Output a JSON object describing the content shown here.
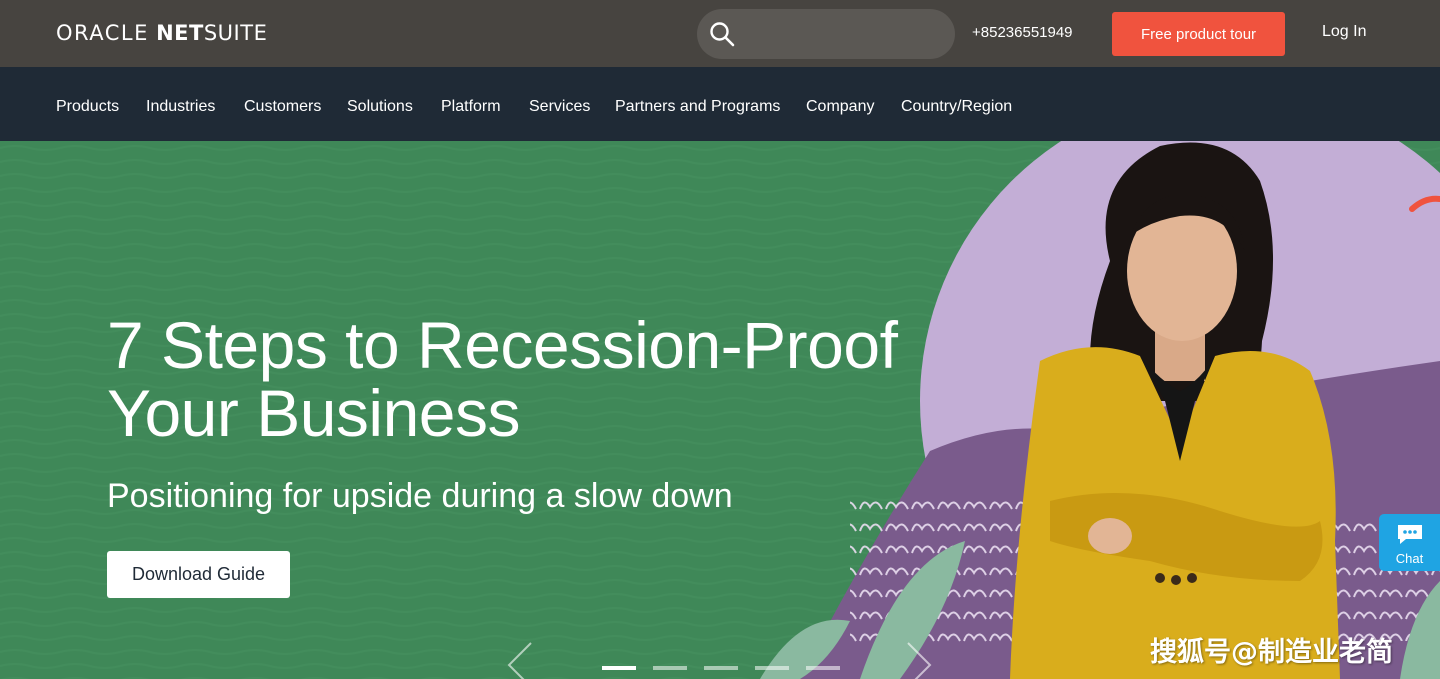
{
  "brand": {
    "logo_part1": "ORACLE",
    "logo_part2": "NET",
    "logo_part3": "SUITE"
  },
  "header": {
    "search_icon": "search-icon",
    "phone": "+85236551949",
    "tour_button": "Free product tour",
    "login": "Log In"
  },
  "nav": {
    "items": [
      {
        "label": "Products"
      },
      {
        "label": "Industries"
      },
      {
        "label": "Customers"
      },
      {
        "label": "Solutions"
      },
      {
        "label": "Platform"
      },
      {
        "label": "Services"
      },
      {
        "label": "Partners and Programs"
      },
      {
        "label": "Company"
      },
      {
        "label": "Country/Region"
      }
    ]
  },
  "hero": {
    "title_line1": "7 Steps to Recession-Proof",
    "title_line2": "Your Business",
    "subtitle": "Positioning for upside during a slow down",
    "cta": "Download Guide",
    "slide_count": 5,
    "active_slide": 1
  },
  "chat": {
    "label": "Chat",
    "icon": "chat-bubble-icon"
  },
  "watermark": "搜狐号@制造业老简",
  "colors": {
    "topbar": "#474440",
    "nav": "#1f2a36",
    "hero_green": "#3f8858",
    "accent": "#f0533e",
    "lavender": "#c3aed6",
    "purple": "#7a5b8c",
    "blazer_yellow": "#d9ad1c",
    "chat_blue": "#1fa4e3"
  }
}
